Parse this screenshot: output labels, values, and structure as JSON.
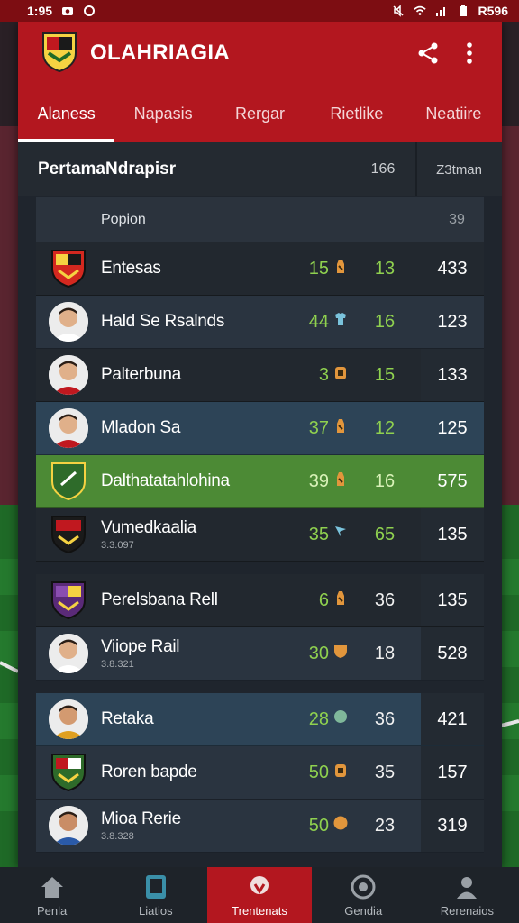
{
  "status": {
    "time": "1:95",
    "battery": "R596"
  },
  "app": {
    "title": "OLAHRIAGIA"
  },
  "tabs": [
    {
      "label": "Alaness",
      "active": true
    },
    {
      "label": "Napasis",
      "active": false
    },
    {
      "label": "Rergar",
      "active": false
    },
    {
      "label": "Rietlike",
      "active": false
    },
    {
      "label": "Neatiire",
      "active": false
    }
  ],
  "league": {
    "name": "PertamaNdrapisr",
    "col1": "166",
    "col2": "Z3tman"
  },
  "columns": {
    "label": "Popion",
    "right": "39"
  },
  "rows": [
    {
      "name": "Entesas",
      "sub": "",
      "points": "15",
      "wins": "13",
      "total": "433",
      "style": "dark",
      "badge": "crest-red",
      "gicon": "bottle-icon"
    },
    {
      "name": "Hald Se Rsalnds",
      "sub": "",
      "points": "44",
      "wins": "16",
      "total": "123",
      "style": "slate",
      "badge": "player",
      "gicon": "shirt-icon"
    },
    {
      "name": "Palterbuna",
      "sub": "",
      "points": "3",
      "wins": "15",
      "total": "133",
      "style": "dark",
      "badge": "player-red",
      "gicon": "jar-icon"
    },
    {
      "name": "Mladon Sa",
      "sub": "",
      "points": "37",
      "wins": "12",
      "total": "125",
      "style": "blue",
      "badge": "player-red",
      "gicon": "bottle-icon"
    },
    {
      "name": "Dalthatatahlohina",
      "sub": "",
      "points": "39",
      "wins": "16",
      "total": "575",
      "style": "green",
      "badge": "crest-green",
      "gicon": "bottle-icon"
    },
    {
      "name": "Vumedkaalia",
      "sub": "3.3.097",
      "points": "35",
      "wins": "65",
      "total": "135",
      "style": "dark",
      "badge": "crest-dark",
      "gicon": "flag-icon"
    },
    {
      "name": "Perelsbana Rell",
      "sub": "",
      "points": "6",
      "wins": "36",
      "total": "135",
      "style": "dark",
      "badge": "crest-purple",
      "gicon": "bottle-icon"
    },
    {
      "name": "Viiope Rail",
      "sub": "3.8.321",
      "points": "30",
      "wins": "18",
      "total": "528",
      "style": "slate",
      "badge": "player",
      "gicon": "shield-icon"
    },
    {
      "name": "Retaka",
      "sub": "",
      "points": "28",
      "wins": "36",
      "total": "421",
      "style": "blue",
      "badge": "player-gold",
      "gicon": "ball-icon"
    },
    {
      "name": "Roren bapde",
      "sub": "",
      "points": "50",
      "wins": "35",
      "total": "157",
      "style": "slate",
      "badge": "crest-green2",
      "gicon": "jar-icon"
    },
    {
      "name": "Mioa Rerie",
      "sub": "3.8.328",
      "points": "50",
      "wins": "23",
      "total": "319",
      "style": "slate",
      "badge": "player-blue",
      "gicon": "coin-icon"
    }
  ],
  "nav": [
    {
      "label": "Penla",
      "icon": "home-icon",
      "active": false
    },
    {
      "label": "Liatios",
      "icon": "tablet-icon",
      "active": false
    },
    {
      "label": "Trentenats",
      "icon": "trophy-icon",
      "active": true
    },
    {
      "label": "Gendia",
      "icon": "clock-icon",
      "active": false
    },
    {
      "label": "Rerenaios",
      "icon": "profile-icon",
      "active": false
    }
  ],
  "colors": {
    "primary": "#b3171f",
    "accent_green": "#8fd14f",
    "highlight_row": "#4c8a35"
  }
}
